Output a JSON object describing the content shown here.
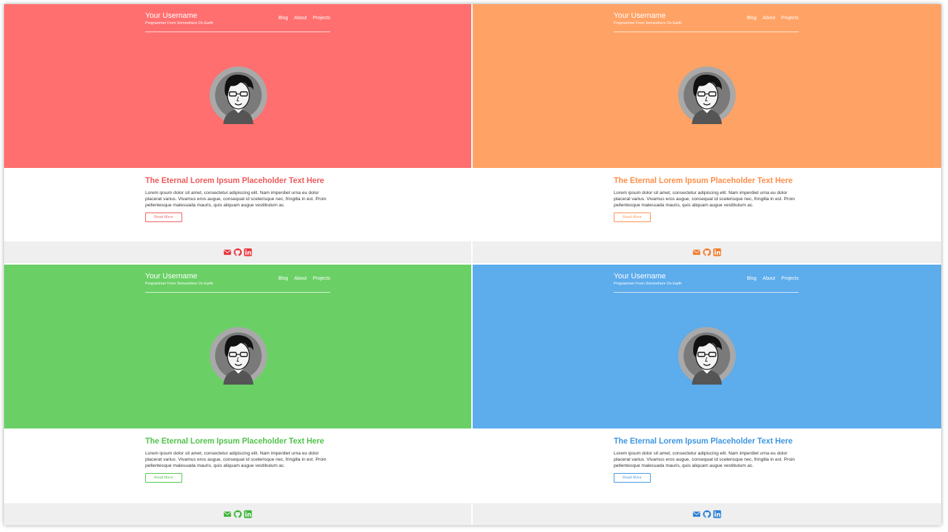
{
  "panels": [
    {
      "accent": "#ff6f6f",
      "text_accent": "#ee5a5a",
      "icon_color": "#e8323a",
      "username": "Your Username",
      "tagline": "Programmer From Somewhere On Earth",
      "nav": [
        "Blog",
        "About",
        "Projects"
      ],
      "post_title": "The Eternal Lorem Ipsum Placeholder Text Here",
      "post_excerpt": "Lorem ipsum dolor sit amet, consectetur adipiscing elit. Nam imperdiet urna eu dolor placerat varius. Vivamus eros augue, consequat id scelerisque nec, fringilla in est. Proin pellentesque malesuada mauris, quis aliquam augue vestibulum ac.",
      "read_more": "Read More",
      "icons": [
        "envelope-icon",
        "github-icon",
        "linkedin-icon"
      ]
    },
    {
      "accent": "#ffa265",
      "text_accent": "#ff8e4a",
      "icon_color": "#f07a2a",
      "username": "Your Username",
      "tagline": "Programmer From Somewhere On Earth",
      "nav": [
        "Blog",
        "About",
        "Projects"
      ],
      "post_title": "The Eternal Lorem Ipsum Placeholder Text Here",
      "post_excerpt": "Lorem ipsum dolor sit amet, consectetur adipiscing elit. Nam imperdiet urna eu dolor placerat varius. Vivamus eros augue, consequat id scelerisque nec, fringilla in est. Proin pellentesque malesuada mauris, quis aliquam augue vestibulum ac.",
      "read_more": "Read More",
      "icons": [
        "envelope-icon",
        "github-icon",
        "linkedin-icon"
      ]
    },
    {
      "accent": "#6ad066",
      "text_accent": "#4fc34a",
      "icon_color": "#3ab535",
      "username": "Your Username",
      "tagline": "Programmer From Somewhere On Earth",
      "nav": [
        "Blog",
        "About",
        "Projects"
      ],
      "post_title": "The Eternal Lorem Ipsum Placeholder Text Here",
      "post_excerpt": "Lorem ipsum dolor sit amet, consectetur adipiscing elit. Nam imperdiet urna eu dolor placerat varius. Vivamus eros augue, consequat id scelerisque nec, fringilla in est. Proin pellentesque malesuada mauris, quis aliquam augue vestibulum ac.",
      "read_more": "Read More",
      "icons": [
        "envelope-icon",
        "github-icon",
        "linkedin-icon"
      ]
    },
    {
      "accent": "#5dacec",
      "text_accent": "#3d95e0",
      "icon_color": "#2a7fd6",
      "username": "Your Username",
      "tagline": "Programmer From Somewhere On Earth",
      "nav": [
        "Blog",
        "About",
        "Projects"
      ],
      "post_title": "The Eternal Lorem Ipsum Placeholder Text Here",
      "post_excerpt": "Lorem ipsum dolor sit amet, consectetur adipiscing elit. Nam imperdiet urna eu dolor placerat varius. Vivamus eros augue, consequat id scelerisque nec, fringilla in est. Proin pellentesque malesuada mauris, quis aliquam augue vestibulum ac.",
      "read_more": "Read More",
      "icons": [
        "envelope-icon",
        "github-icon",
        "linkedin-icon"
      ]
    }
  ]
}
